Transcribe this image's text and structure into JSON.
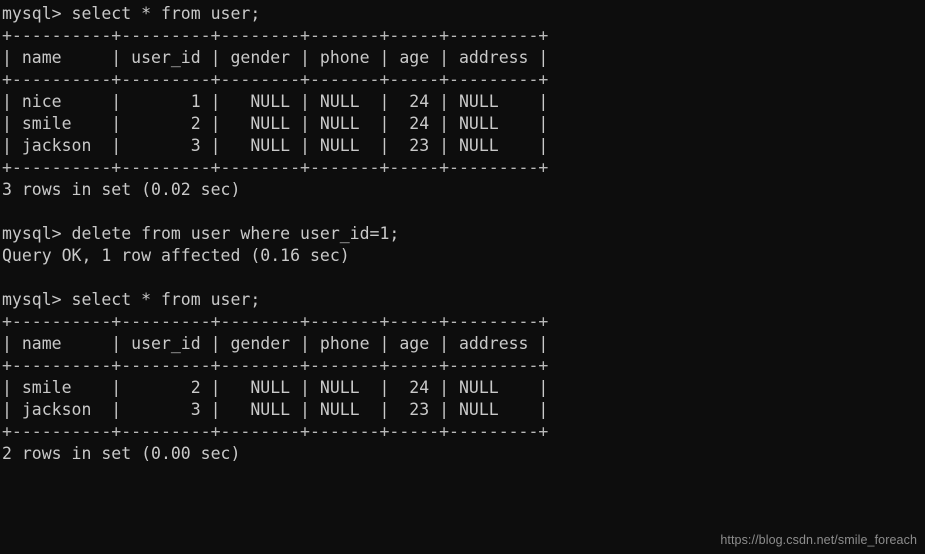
{
  "terminal": {
    "prompt": "mysql> ",
    "background_color": "#0d0d0d",
    "text_color": "#c9c9c9",
    "watermark": "https://blog.csdn.net/smile_foreach",
    "lines": [
      "mysql> select * from user;",
      "+----------+---------+--------+-------+-----+---------+",
      "| name     | user_id | gender | phone | age | address |",
      "+----------+---------+--------+-------+-----+---------+",
      "| nice     |       1 |   NULL | NULL  |  24 | NULL    |",
      "| smile    |       2 |   NULL | NULL  |  24 | NULL    |",
      "| jackson  |       3 |   NULL | NULL  |  23 | NULL    |",
      "+----------+---------+--------+-------+-----+---------+",
      "3 rows in set (0.02 sec)",
      "",
      "mysql> delete from user where user_id=1;",
      "Query OK, 1 row affected (0.16 sec)",
      "",
      "mysql> select * from user;",
      "+----------+---------+--------+-------+-----+---------+",
      "| name     | user_id | gender | phone | age | address |",
      "+----------+---------+--------+-------+-----+---------+",
      "| smile    |       2 |   NULL | NULL  |  24 | NULL    |",
      "| jackson  |       3 |   NULL | NULL  |  23 | NULL    |",
      "+----------+---------+--------+-------+-----+---------+",
      "2 rows in set (0.00 sec)"
    ],
    "statements": [
      {
        "command": "select * from user;",
        "status": "3 rows in set (0.02 sec)",
        "columns": [
          "name",
          "user_id",
          "gender",
          "phone",
          "age",
          "address"
        ],
        "rows": [
          [
            "nice",
            "1",
            "NULL",
            "NULL",
            "24",
            "NULL"
          ],
          [
            "smile",
            "2",
            "NULL",
            "NULL",
            "24",
            "NULL"
          ],
          [
            "jackson",
            "3",
            "NULL",
            "NULL",
            "23",
            "NULL"
          ]
        ]
      },
      {
        "command": "delete from user where user_id=1;",
        "status": "Query OK, 1 row affected (0.16 sec)",
        "columns": [],
        "rows": []
      },
      {
        "command": "select * from user;",
        "status": "2 rows in set (0.00 sec)",
        "columns": [
          "name",
          "user_id",
          "gender",
          "phone",
          "age",
          "address"
        ],
        "rows": [
          [
            "smile",
            "2",
            "NULL",
            "NULL",
            "24",
            "NULL"
          ],
          [
            "jackson",
            "3",
            "NULL",
            "NULL",
            "23",
            "NULL"
          ]
        ]
      }
    ]
  }
}
